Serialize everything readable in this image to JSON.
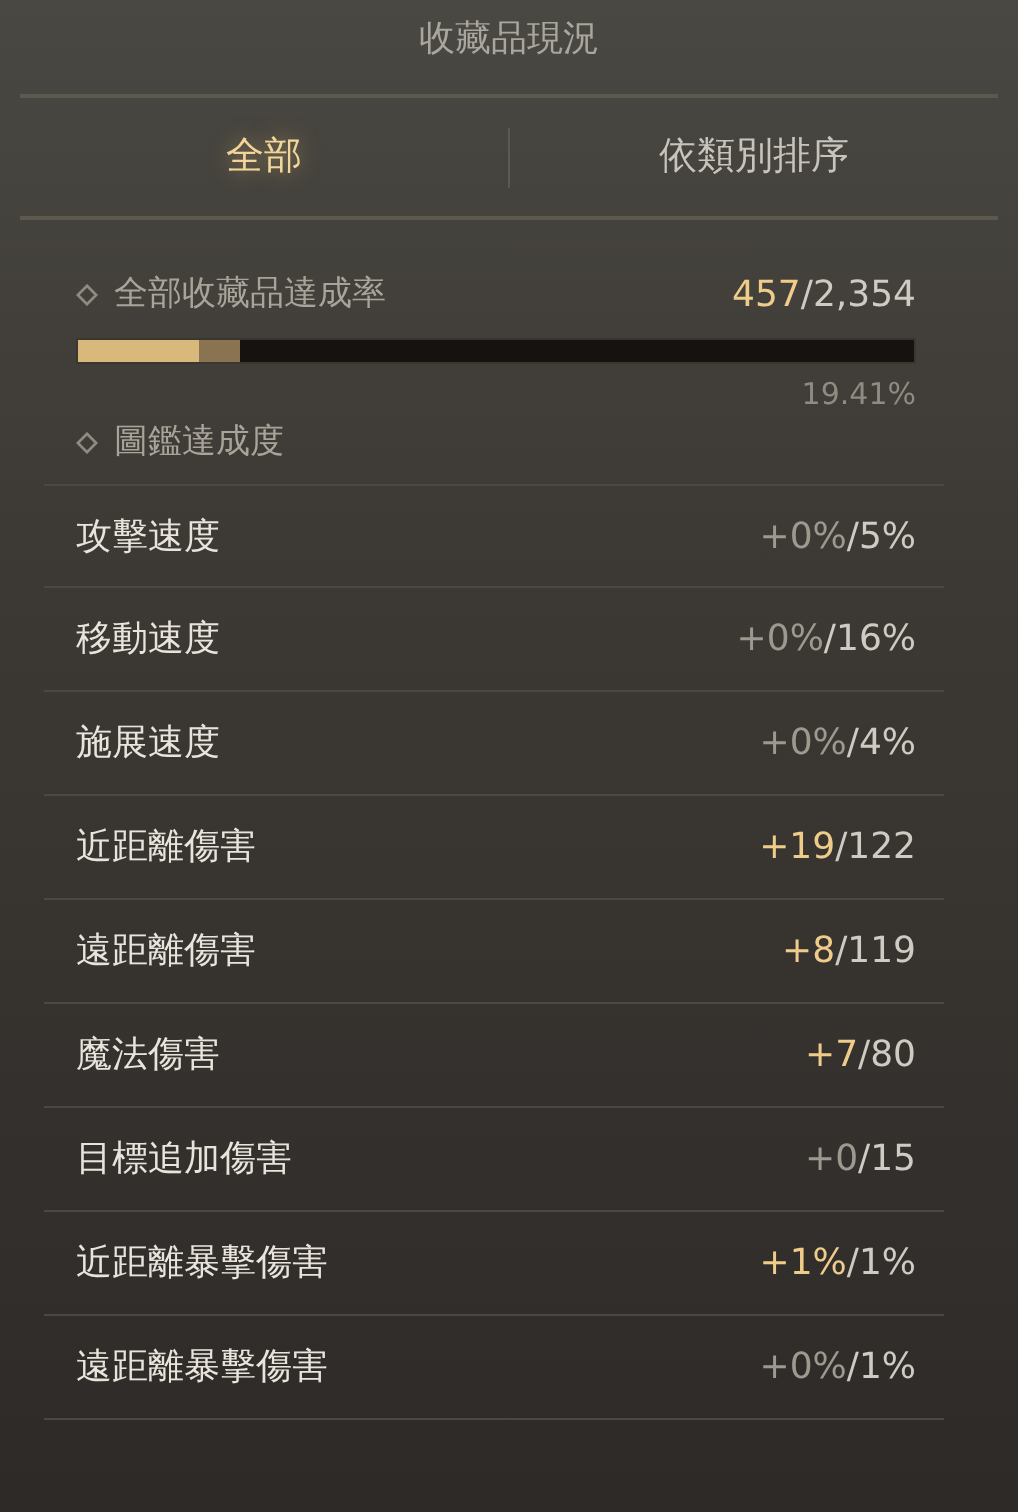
{
  "title": "收藏品現況",
  "tabs": [
    {
      "label": "全部",
      "selected": true
    },
    {
      "label": "依類別排序",
      "selected": false
    }
  ],
  "overall": {
    "label": "全部收藏品達成率",
    "collected": "457",
    "total": "/2,354",
    "level": 0.1941,
    "percent": "19.41%"
  },
  "section": {
    "label": "圖鑑達成度"
  },
  "stats": [
    {
      "name": "攻擊速度",
      "gained": "+0%",
      "total": "/5%",
      "active": false
    },
    {
      "name": "移動速度",
      "gained": "+0%",
      "total": "/16%",
      "active": false
    },
    {
      "name": "施展速度",
      "gained": "+0%",
      "total": "/4%",
      "active": false
    },
    {
      "name": "近距離傷害",
      "gained": "+19",
      "total": "/122",
      "active": true
    },
    {
      "name": "遠距離傷害",
      "gained": "+8",
      "total": "/119",
      "active": true
    },
    {
      "name": "魔法傷害",
      "gained": "+7",
      "total": "/80",
      "active": true
    },
    {
      "name": "目標追加傷害",
      "gained": "+0",
      "total": "/15",
      "active": false
    },
    {
      "name": "近距離暴擊傷害",
      "gained": "+1%",
      "total": "/1%",
      "active": true
    },
    {
      "name": "遠距離暴擊傷害",
      "gained": "+0%",
      "total": "/1%",
      "active": false
    }
  ]
}
